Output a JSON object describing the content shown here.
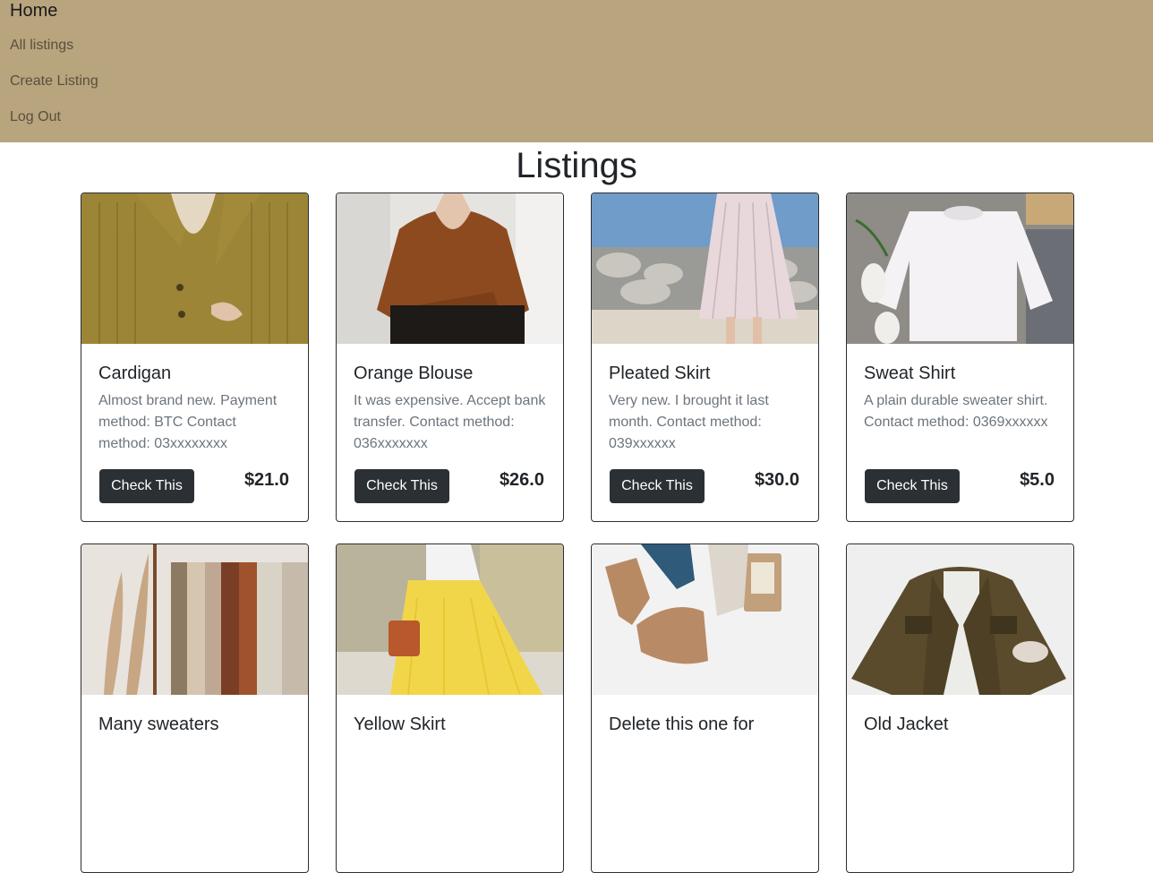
{
  "nav": {
    "brand": "Home",
    "links": [
      "All listings",
      "Create Listing",
      "Log Out"
    ]
  },
  "page": {
    "title": "Listings"
  },
  "listings": [
    {
      "title": "Cardigan",
      "description": "Almost brand new. Payment method: BTC Contact method: 03xxxxxxxx",
      "button": "Check This",
      "price": "$21.0"
    },
    {
      "title": "Orange Blouse",
      "description": "It was expensive. Accept bank transfer. Contact method: 036xxxxxxx",
      "button": "Check This",
      "price": "$26.0"
    },
    {
      "title": "Pleated Skirt",
      "description": "Very new. I brought it last month. Contact method: 039xxxxxx",
      "button": "Check This",
      "price": "$30.0"
    },
    {
      "title": "Sweat Shirt",
      "description": "A plain durable sweater shirt. Contact method: 0369xxxxxx",
      "button": "Check This",
      "price": "$5.0"
    },
    {
      "title": "Many sweaters"
    },
    {
      "title": "Yellow Skirt"
    },
    {
      "title": "Delete this one for"
    },
    {
      "title": "Old Jacket"
    }
  ],
  "colors": {
    "navbar_bg": "#b8a47d",
    "button_bg": "#2b3035"
  }
}
